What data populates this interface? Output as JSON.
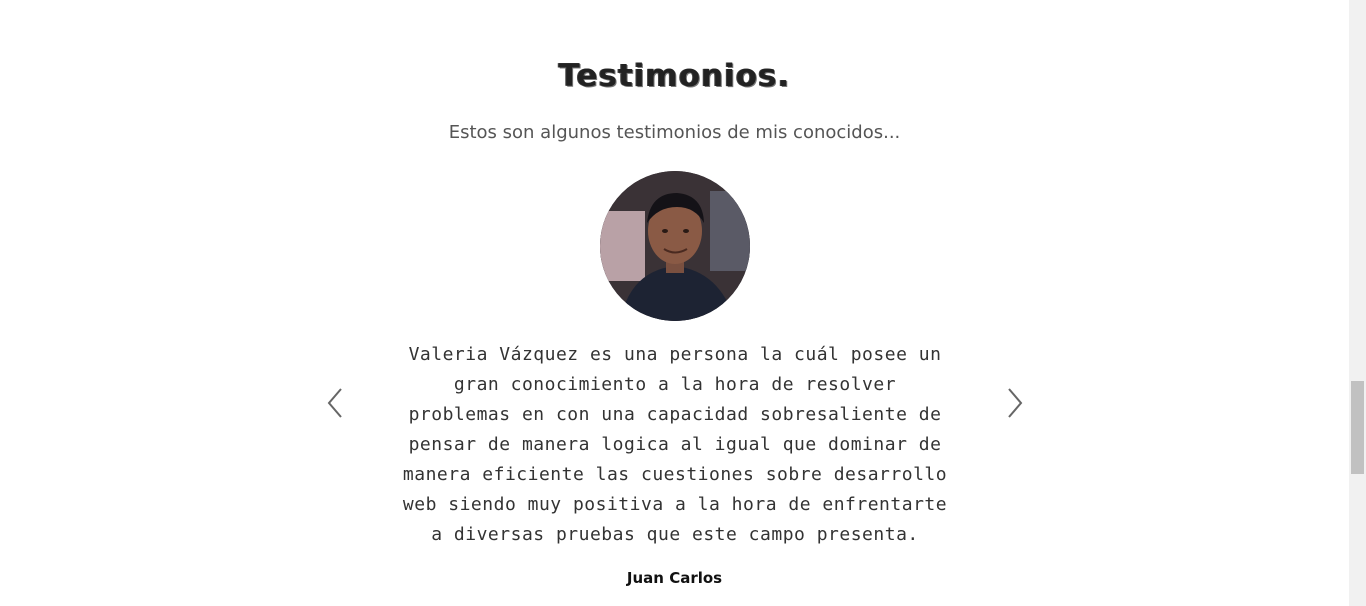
{
  "section": {
    "title": "Testimonios.",
    "subtitle": "Estos son algunos testimonios de mis conocidos..."
  },
  "testimonial": {
    "quote": "Valeria Vázquez es una persona la cuál posee un gran conocimiento a la hora de resolver problemas en con una capacidad sobresaliente de pensar de manera logica al igual que dominar de manera eficiente las cuestiones sobre desarrollo web siendo muy positiva a la hora de enfrentarte a diversas pruebas que este campo presenta.",
    "author": "Juan Carlos",
    "avatar_icon": "person-photo"
  },
  "controls": {
    "prev_icon": "chevron-left-icon",
    "next_icon": "chevron-right-icon"
  }
}
